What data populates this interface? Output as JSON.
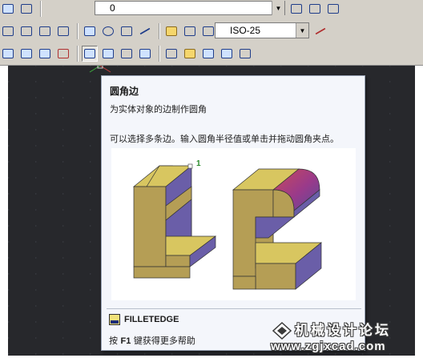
{
  "toolbar": {
    "layer_value": "0",
    "dimstyle_value": "ISO-25"
  },
  "tooltip": {
    "title": "圆角边",
    "description": "为实体对象的边制作圆角",
    "detail": "可以选择多条边。输入圆角半径值或单击并拖动圆角夹点。",
    "illustration_callout": "1",
    "command": "FILLETEDGE",
    "help_key": "F1",
    "help_prefix": "按",
    "help_suffix": "键获得更多帮助"
  },
  "watermark": {
    "title": "机械设计论坛",
    "url": "www.zgjxcad.com"
  },
  "colors": {
    "toolbar_bg": "#d4d0c8",
    "canvas_bg": "#27282c",
    "tooltip_bg": "#f4f6fb",
    "solid_top": "#d8c660",
    "solid_front": "#b59e55",
    "solid_side": "#6a5ea8"
  }
}
